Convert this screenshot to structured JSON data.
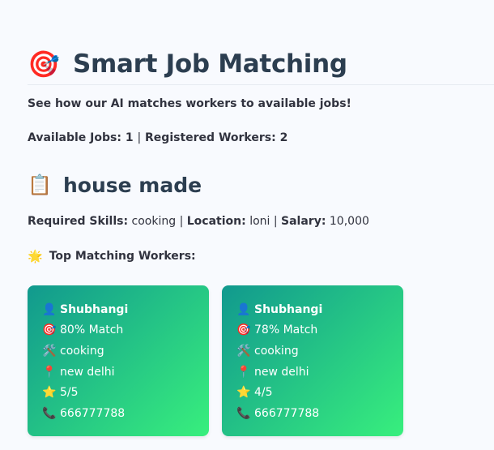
{
  "header": {
    "title_icon": "target-icon",
    "title": "Smart Job Matching"
  },
  "intro": "See how our AI matches workers to available jobs!",
  "counts": {
    "available_label": "Available Jobs:",
    "available_value": "1",
    "separator": "|",
    "workers_label": "Registered Workers:",
    "workers_value": "2"
  },
  "job": {
    "icon": "clipboard-icon",
    "title": "house made",
    "skills_label": "Required Skills:",
    "skills_value": "cooking",
    "location_label": "Location:",
    "location_value": "loni",
    "salary_label": "Salary:",
    "salary_value": "10,000",
    "separator": "|"
  },
  "top_matches": {
    "icon": "sun-icon",
    "label": "Top Matching Workers:"
  },
  "workers": [
    {
      "name": "Shubhangi",
      "match": "80% Match",
      "skill": "cooking",
      "location": "new delhi",
      "rating": "5/5",
      "phone": "666777788"
    },
    {
      "name": "Shubhangi",
      "match": "78% Match",
      "skill": "cooking",
      "location": "new delhi",
      "rating": "4/5",
      "phone": "666777788"
    }
  ],
  "colors": {
    "card_gradient_start": "#11998e",
    "card_gradient_end": "#38ef7d",
    "heading": "#2c3e50",
    "background": "#f8fafe"
  }
}
